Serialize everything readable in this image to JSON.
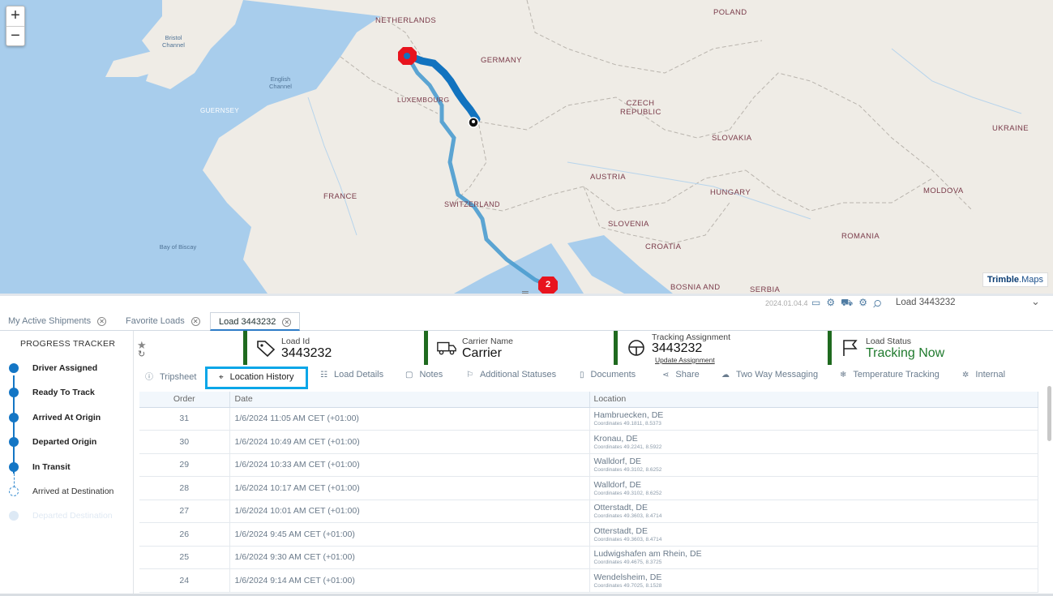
{
  "map": {
    "zoom_in": "+",
    "zoom_out": "−",
    "countries": [
      {
        "name": "NETHERLANDS"
      },
      {
        "name": "POLAND"
      },
      {
        "name": "GERMANY"
      },
      {
        "name": "LUXEMBOURG"
      },
      {
        "name": "CZECH REPUBLIC"
      },
      {
        "name": "UKRAINE"
      },
      {
        "name": "SLOVAKIA"
      },
      {
        "name": "AUSTRIA"
      },
      {
        "name": "FRANCE"
      },
      {
        "name": "SWITZERLAND"
      },
      {
        "name": "HUNGARY"
      },
      {
        "name": "MOLDOVA"
      },
      {
        "name": "SLOVENIA"
      },
      {
        "name": "CROATIA"
      },
      {
        "name": "ROMANIA"
      },
      {
        "name": "GUERNSEY"
      },
      {
        "name": "BOSNIA AND"
      },
      {
        "name": "SERBIA"
      }
    ],
    "seas": [
      "Bristol Channel",
      "English Channel",
      "Bay of Biscay"
    ],
    "cluster_count": "2",
    "brand": "Trimble",
    "brand_suffix": "Maps"
  },
  "toolbar": {
    "version": "2024.01.04.4",
    "load_selector": "Load 3443232",
    "chevron": "⌄"
  },
  "tabs": [
    {
      "label": "My Active Shipments",
      "active": false
    },
    {
      "label": "Favorite Loads",
      "active": false
    },
    {
      "label": "Load 3443232",
      "active": true
    }
  ],
  "tracker": {
    "title": "PROGRESS TRACKER",
    "steps": [
      {
        "label": "Driver Assigned",
        "state": "done"
      },
      {
        "label": "Ready To Track",
        "state": "done"
      },
      {
        "label": "Arrived At Origin",
        "state": "done"
      },
      {
        "label": "Departed Origin",
        "state": "done"
      },
      {
        "label": "In Transit",
        "state": "done"
      },
      {
        "label": "Arrived at Destination",
        "state": "pending"
      },
      {
        "label": "Departed Destination",
        "state": "future"
      }
    ]
  },
  "header": {
    "load_id_caption": "Load Id",
    "load_id": "3443232",
    "carrier_caption": "Carrier Name",
    "carrier": "Carrier",
    "tracking_caption": "Tracking Assignment",
    "tracking": "3443232",
    "update_assignment": "Update Assignment",
    "status_caption": "Load Status",
    "status": "Tracking Now",
    "status_color": "#1f7a2d"
  },
  "subtabs": [
    {
      "label": "Tripsheet",
      "icon": "info-icon"
    },
    {
      "label": "Location History",
      "icon": "target-icon",
      "active": true
    },
    {
      "label": "Load Details",
      "icon": "details-icon"
    },
    {
      "label": "Notes",
      "icon": "note-icon"
    },
    {
      "label": "Additional Statuses",
      "icon": "flag-icon"
    },
    {
      "label": "Documents",
      "icon": "document-icon"
    },
    {
      "label": "Share",
      "icon": "share-icon"
    },
    {
      "label": "Two Way Messaging",
      "icon": "chat-icon"
    },
    {
      "label": "Temperature Tracking",
      "icon": "thermometer-icon"
    },
    {
      "label": "Internal",
      "icon": "bug-icon"
    }
  ],
  "table": {
    "columns": [
      "Order",
      "Date",
      "Location"
    ],
    "coord_label": "Coordinates",
    "rows": [
      {
        "order": "31",
        "date": "1/6/2024   11:05 AM  CET (+01:00)",
        "city": "Hambruecken, DE",
        "coords": "49.1811, 8.5373"
      },
      {
        "order": "30",
        "date": "1/6/2024   10:49 AM  CET (+01:00)",
        "city": "Kronau, DE",
        "coords": "49.2241, 8.5922"
      },
      {
        "order": "29",
        "date": "1/6/2024   10:33 AM  CET (+01:00)",
        "city": "Walldorf, DE",
        "coords": "49.3102, 8.6252"
      },
      {
        "order": "28",
        "date": "1/6/2024   10:17 AM  CET (+01:00)",
        "city": "Walldorf, DE",
        "coords": "49.3102, 8.6252"
      },
      {
        "order": "27",
        "date": "1/6/2024   10:01 AM  CET (+01:00)",
        "city": "Otterstadt, DE",
        "coords": "49.3603, 8.4714"
      },
      {
        "order": "26",
        "date": "1/6/2024   9:45 AM  CET (+01:00)",
        "city": "Otterstadt, DE",
        "coords": "49.3603, 8.4714"
      },
      {
        "order": "25",
        "date": "1/6/2024   9:30 AM  CET (+01:00)",
        "city": "Ludwigshafen am Rhein, DE",
        "coords": "49.4675, 8.3725"
      },
      {
        "order": "24",
        "date": "1/6/2024   9:14 AM  CET (+01:00)",
        "city": "Wendelsheim, DE",
        "coords": "49.7025, 8.1528"
      }
    ]
  },
  "colors": {
    "accent": "#1476c5",
    "active_subtab_border": "#0aa6e8",
    "header_bar": "#1f6a1f",
    "route": "#4a9ccf",
    "origin_marker": "#e8141e"
  }
}
